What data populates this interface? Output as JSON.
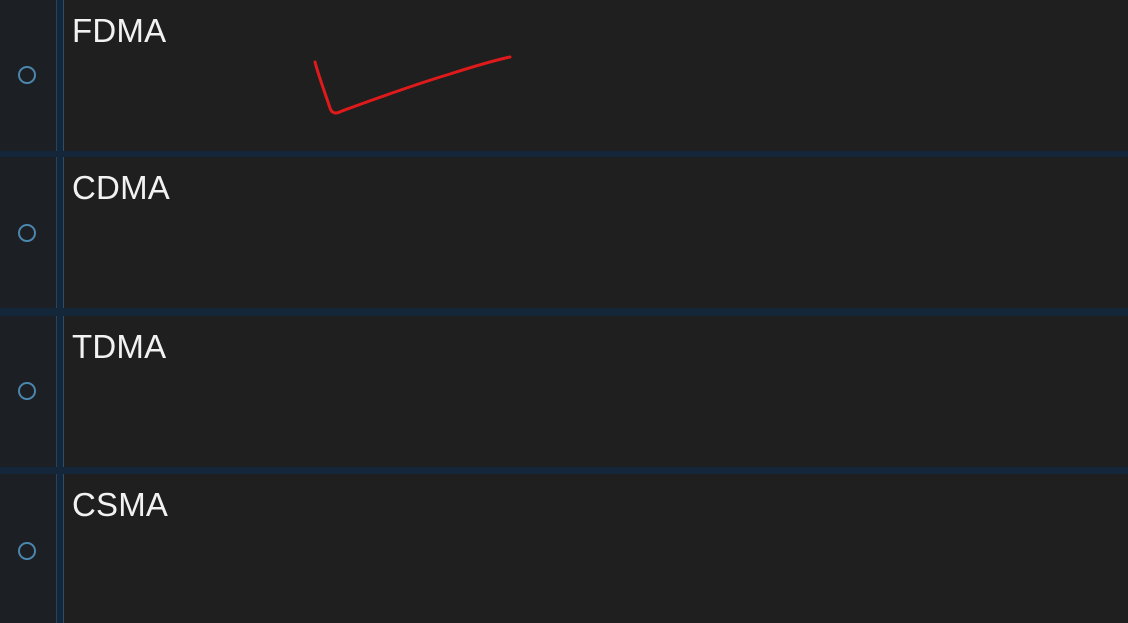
{
  "colors": {
    "row_background": "#1f1f1f",
    "radio_column_background": "#1c1f24",
    "separator": "#14263a",
    "radio_ring": "#4b87ad",
    "label_text": "#f2f2f2",
    "annotation_stroke": "#e01a1a"
  },
  "options": [
    {
      "label": "FDMA",
      "icon": "radio-unchecked-icon"
    },
    {
      "label": "CDMA",
      "icon": "radio-unchecked-icon"
    },
    {
      "label": "TDMA",
      "icon": "radio-unchecked-icon"
    },
    {
      "label": "CSMA",
      "icon": "radio-unchecked-icon"
    }
  ],
  "annotation": {
    "type": "handwritten-checkmark",
    "marks_option": "FDMA"
  }
}
